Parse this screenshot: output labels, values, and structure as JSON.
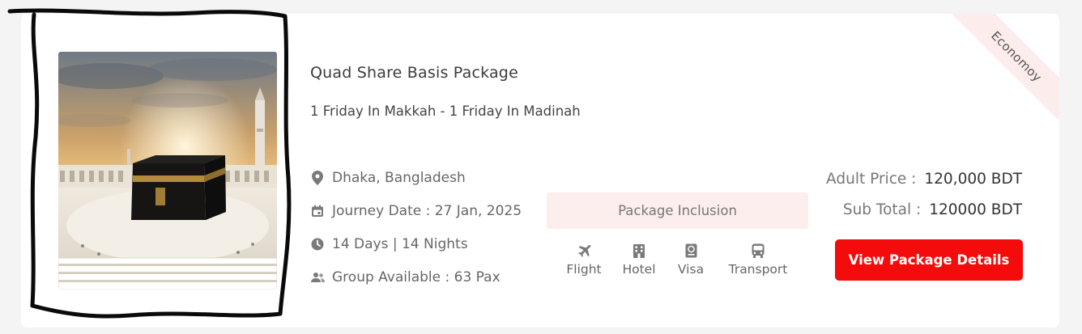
{
  "package": {
    "badge": "Economoy",
    "title": "Quad Share Basis Package",
    "subtitle": "1 Friday In Makkah - 1 Friday In Madinah",
    "details": [
      {
        "icon": "location-pin-icon",
        "text": "Dhaka, Bangladesh"
      },
      {
        "icon": "calendar-icon",
        "text": "Journey Date : 27 Jan, 2025"
      },
      {
        "icon": "clock-icon",
        "text": "14 Days | 14 Nights"
      },
      {
        "icon": "group-icon",
        "text": "Group Available : 63 Pax"
      }
    ],
    "inclusion_title": "Package Inclusion",
    "inclusions": [
      {
        "icon": "airplane-icon",
        "label": "Flight"
      },
      {
        "icon": "hotel-icon",
        "label": "Hotel"
      },
      {
        "icon": "visa-icon",
        "label": "Visa"
      },
      {
        "icon": "bus-icon",
        "label": "Transport"
      }
    ],
    "adult_price_label": "Adult Price :",
    "adult_price_value": "120,000 BDT",
    "sub_total_label": "Sub Total :",
    "sub_total_value": "120000 BDT",
    "cta_label": "View Package Details",
    "colors": {
      "accent": "#f40b0b",
      "tint": "#fdecec"
    }
  }
}
